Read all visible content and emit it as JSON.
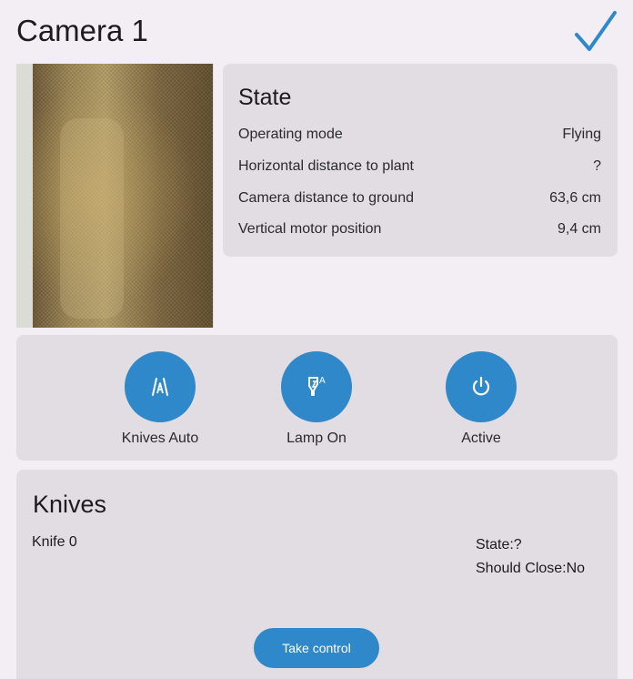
{
  "header": {
    "title": "Camera 1",
    "confirm_icon": "check-icon"
  },
  "state": {
    "title": "State",
    "rows": [
      {
        "label": "Operating mode",
        "value": "Flying"
      },
      {
        "label": "Horizontal distance to plant",
        "value": "?"
      },
      {
        "label": "Camera distance to ground",
        "value": "63,6 cm"
      },
      {
        "label": "Vertical motor position",
        "value": "9,4 cm"
      }
    ]
  },
  "actions": [
    {
      "label": "Knives Auto",
      "icon": "knives-auto-icon"
    },
    {
      "label": "Lamp On",
      "icon": "lamp-auto-icon",
      "icon_letter": "A"
    },
    {
      "label": "Active",
      "icon": "power-icon"
    }
  ],
  "knives": {
    "title": "Knives",
    "items": [
      {
        "name": "Knife 0",
        "state": "State:?",
        "should_close": "Should Close:No"
      }
    ],
    "take_control_label": "Take control"
  },
  "colors": {
    "accent": "#2f88c9",
    "background": "#f3eef3",
    "card": "#e2dde3"
  }
}
